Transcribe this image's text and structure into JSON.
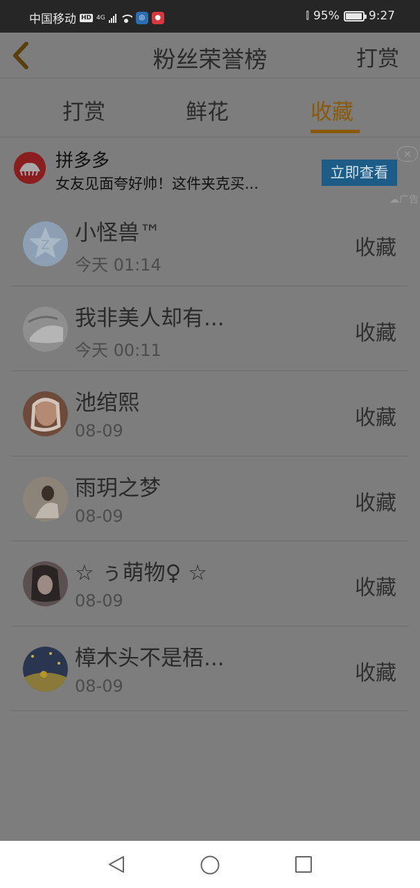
{
  "status_bar": {
    "carrier": "中国移动",
    "hd": "HD",
    "network": "4G",
    "battery": "95%",
    "battery_level": 0.95,
    "time": "9:27"
  },
  "header": {
    "title": "粉丝荣誉榜",
    "action": "打赏"
  },
  "tabs": [
    {
      "label": "打赏",
      "active": false
    },
    {
      "label": "鲜花",
      "active": false
    },
    {
      "label": "收藏",
      "active": true
    }
  ],
  "accent_color": "#8a5a0a",
  "ad": {
    "title": "拼多多",
    "description": "女友见面夸好帅！这件夹克买...",
    "cta": "立即查看",
    "close": "×",
    "badge": "广告"
  },
  "fans": [
    {
      "name": "小怪兽™",
      "time": "今天 01:14",
      "action": "收藏",
      "avatar": "default-star-avatar"
    },
    {
      "name": "我非美人却有...",
      "time": "今天 00:11",
      "action": "收藏",
      "avatar": "photo-avatar"
    },
    {
      "name": "池绾熙",
      "time": "08-09",
      "action": "收藏",
      "avatar": "photo-avatar"
    },
    {
      "name": "雨玥之梦",
      "time": "08-09",
      "action": "收藏",
      "avatar": "photo-avatar"
    },
    {
      "name": "☆ ぅ萌物♀ ☆",
      "time": "08-09",
      "action": "收藏",
      "avatar": "photo-avatar"
    },
    {
      "name": "樟木头不是梧...",
      "time": "08-09",
      "action": "收藏",
      "avatar": "photo-avatar"
    }
  ]
}
